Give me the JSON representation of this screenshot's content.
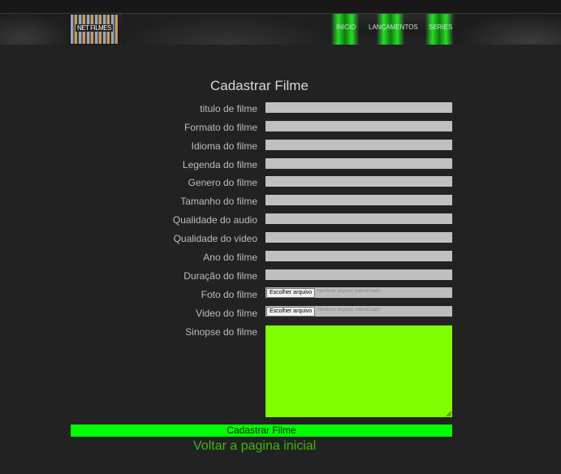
{
  "header": {
    "logo_text": "NET FILMES",
    "nav": [
      "INICIO",
      "LANÇAMENTOS",
      "SERIES"
    ]
  },
  "form": {
    "title": "Cadastrar Filme",
    "fields": [
      {
        "label": "titulo de filme",
        "value": ""
      },
      {
        "label": "Formato do filme",
        "value": ""
      },
      {
        "label": "Idioma do filme",
        "value": ""
      },
      {
        "label": "Legenda do filme",
        "value": ""
      },
      {
        "label": "Genero do filme",
        "value": ""
      },
      {
        "label": "Tamanho do filme",
        "value": ""
      },
      {
        "label": "Qualidade do audio",
        "value": ""
      },
      {
        "label": "Qualidade do video",
        "value": ""
      },
      {
        "label": "Ano do filme",
        "value": ""
      },
      {
        "label": "Duração do filme",
        "value": ""
      }
    ],
    "file_fields": [
      {
        "label": "Foto do filme",
        "button": "Escolher arquivo",
        "status": "Nenhum arquivo selecionado"
      },
      {
        "label": "Video do filme",
        "button": "Escolher arquivo",
        "status": "Nenhum arquivo selecionado"
      }
    ],
    "synopsis_label": "Sinopse do filme",
    "submit_label": "Cadastrar Filme",
    "back_link": "Voltar a pagina inicial"
  },
  "colors": {
    "background": "#222222",
    "input_gray": "#c0c0c0",
    "textarea_green": "#80ff00",
    "submit_green": "#00ff00",
    "link_green": "#3fb80e"
  }
}
